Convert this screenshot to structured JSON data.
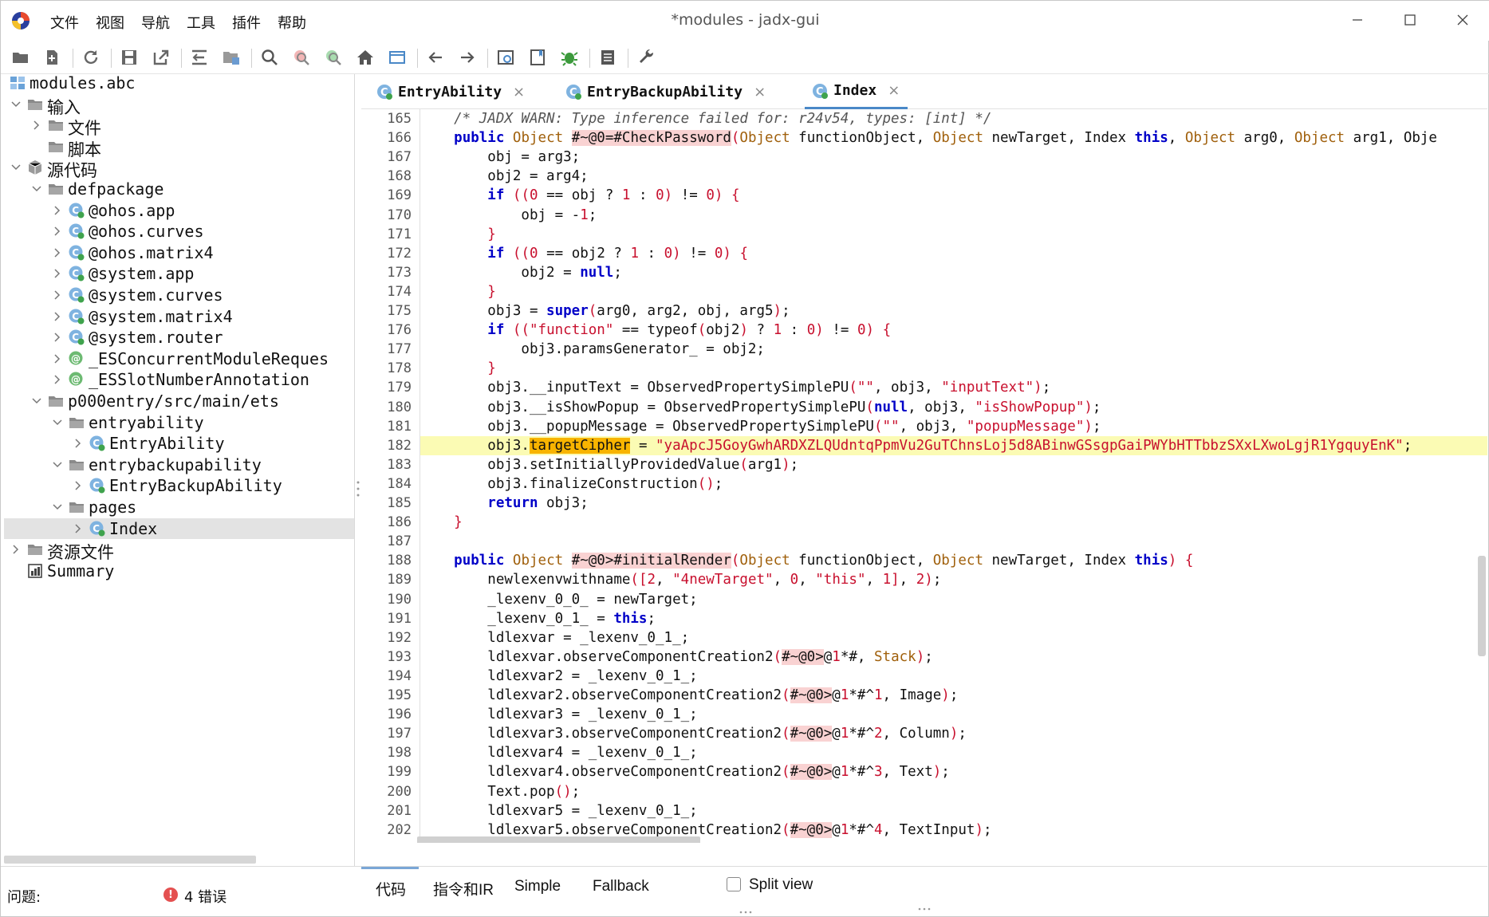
{
  "window": {
    "title": "*modules - jadx-gui",
    "menu": [
      "文件",
      "视图",
      "导航",
      "工具",
      "插件",
      "帮助"
    ]
  },
  "tree": {
    "nodes": [
      {
        "label": "modules.abc",
        "icon": "module-icon",
        "chev": ""
      },
      {
        "label": "输入",
        "icon": "folder-icon",
        "chev": "down"
      },
      {
        "label": "文件",
        "icon": "folder-icon",
        "chev": "right"
      },
      {
        "label": "脚本",
        "icon": "folder-icon",
        "chev": ""
      },
      {
        "label": "源代码",
        "icon": "package-icon",
        "chev": "down"
      },
      {
        "label": "defpackage",
        "icon": "folder-icon",
        "chev": "down"
      },
      {
        "label": "@ohos.app",
        "icon": "class-icon",
        "chev": "right"
      },
      {
        "label": "@ohos.curves",
        "icon": "class-icon",
        "chev": "right"
      },
      {
        "label": "@ohos.matrix4",
        "icon": "class-icon",
        "chev": "right"
      },
      {
        "label": "@system.app",
        "icon": "class-icon",
        "chev": "right"
      },
      {
        "label": "@system.curves",
        "icon": "class-icon",
        "chev": "right"
      },
      {
        "label": "@system.matrix4",
        "icon": "class-icon",
        "chev": "right"
      },
      {
        "label": "@system.router",
        "icon": "class-icon",
        "chev": "right"
      },
      {
        "label": "_ESConcurrentModuleReques",
        "icon": "annotation-icon",
        "chev": "right"
      },
      {
        "label": "_ESSlotNumberAnnotation",
        "icon": "annotation-icon",
        "chev": "right"
      },
      {
        "label": "p000entry/src/main/ets",
        "icon": "folder-icon",
        "chev": "down"
      },
      {
        "label": "entryability",
        "icon": "folder-icon",
        "chev": "down"
      },
      {
        "label": "EntryAbility",
        "icon": "class-icon",
        "chev": "right"
      },
      {
        "label": "entrybackupability",
        "icon": "folder-icon",
        "chev": "down"
      },
      {
        "label": "EntryBackupAbility",
        "icon": "class-icon",
        "chev": "right"
      },
      {
        "label": "pages",
        "icon": "folder-icon",
        "chev": "down"
      },
      {
        "label": "Index",
        "icon": "class-icon",
        "chev": "right"
      },
      {
        "label": "资源文件",
        "icon": "folder-icon",
        "chev": "right"
      },
      {
        "label": "Summary",
        "icon": "summary-icon",
        "chev": ""
      }
    ]
  },
  "tabs": [
    {
      "label": "EntryAbility",
      "close": "×"
    },
    {
      "label": "EntryBackupAbility",
      "close": "×"
    },
    {
      "label": "Index",
      "close": "×"
    }
  ],
  "code": {
    "first_line": 165,
    "lines": [
      "    /* JADX WARN: Type inference failed for: r24v54, types: [int] */",
      "    public Object #~@0=#CheckPassword(Object functionObject, Object newTarget, Index this, Object arg0, Object arg1, Obje",
      "        obj = arg3;",
      "        obj2 = arg4;",
      "        if ((0 == obj ? 1 : 0) != 0) {",
      "            obj = -1;",
      "        }",
      "        if ((0 == obj2 ? 1 : 0) != 0) {",
      "            obj2 = null;",
      "        }",
      "        obj3 = super(arg0, arg2, obj, arg5);",
      "        if ((\"function\" == typeof(obj2) ? 1 : 0) != 0) {",
      "            obj3.paramsGenerator_ = obj2;",
      "        }",
      "        obj3.__inputText = ObservedPropertySimplePU(\"\", obj3, \"inputText\");",
      "        obj3.__isShowPopup = ObservedPropertySimplePU(null, obj3, \"isShowPopup\");",
      "        obj3.__popupMessage = ObservedPropertySimplePU(\"\", obj3, \"popupMessage\");",
      "        obj3.targetCipher = \"yaApcJ5GoyGwhARDXZLQUdntqPpmVu2GuTChnsLoj5d8ABinwGSsgpGaiPWYbHTTbbzSXxLXwoLgjR1YgquyEnK\";",
      "        obj3.setInitiallyProvidedValue(arg1);",
      "        obj3.finalizeConstruction();",
      "        return obj3;",
      "    }",
      "",
      "    public Object #~@0>#initialRender(Object functionObject, Object newTarget, Index this) {",
      "        newlexenvwithname([2, \"4newTarget\", 0, \"this\", 1], 2);",
      "        _lexenv_0_0_ = newTarget;",
      "        _lexenv_0_1_ = this;",
      "        ldlexvar = _lexenv_0_1_;",
      "        ldlexvar.observeComponentCreation2(#~@0>@1*#, Stack);",
      "        ldlexvar2 = _lexenv_0_1_;",
      "        ldlexvar2.observeComponentCreation2(#~@0>@1*#^1, Image);",
      "        ldlexvar3 = _lexenv_0_1_;",
      "        ldlexvar3.observeComponentCreation2(#~@0>@1*#^2, Column);",
      "        ldlexvar4 = _lexenv_0_1_;",
      "        ldlexvar4.observeComponentCreation2(#~@0>@1*#^3, Text);",
      "        Text.pop();",
      "        ldlexvar5 = _lexenv_0_1_;",
      "        ldlexvar5.observeComponentCreation2(#~@0>@1*#^4, TextInput);"
    ],
    "highlighted_line": 182
  },
  "bottom_tabs": [
    "代码",
    "指令和IR",
    "Simple",
    "Fallback"
  ],
  "split_view_label": "Split view",
  "status": {
    "problems_label": "问题:",
    "errors": "4 错误"
  },
  "colors": {
    "keyword": "#0000c8",
    "string": "#c8102e",
    "type": "#a0600c",
    "highlight": "#fbfbb4",
    "selection": "#e3e3e3"
  }
}
